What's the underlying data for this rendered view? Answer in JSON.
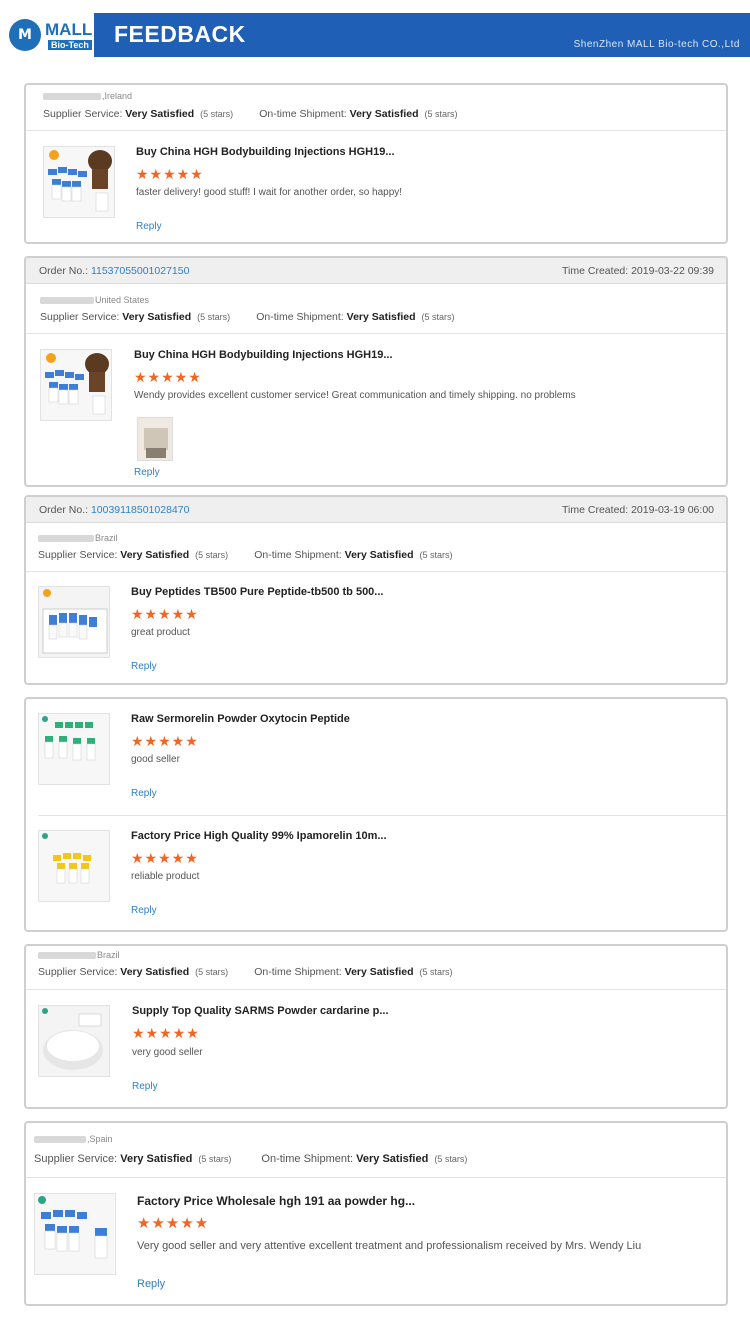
{
  "header": {
    "logo_mark": "M",
    "logo_text": "MALL",
    "logo_sub": "Bio-Tech",
    "title": "FEEDBACK",
    "company": "ShenZhen MALL Bio-tech CO.,Ltd"
  },
  "labels": {
    "order_no": "Order No.: ",
    "time_created": "Time Created: ",
    "supplier_service": "Supplier Service: ",
    "on_time_shipment": "On-time Shipment: ",
    "very_satisfied": "Very Satisfied",
    "five_stars": "(5 stars)",
    "reply": "Reply",
    "stars": "★★★★★"
  },
  "reviews": [
    {
      "country": ",Ireland",
      "product": "Buy China HGH Bodybuilding Injections HGH19...",
      "comment": "faster delivery! good stuff! I wait for another order, so happy!"
    },
    {
      "order_no": "11537055001027150",
      "time": "2019-03-22 09:39",
      "country": "United States",
      "product": "Buy China HGH Bodybuilding Injections HGH19...",
      "comment": "Wendy provides excellent customer service! Great communication and timely shipping. no problems"
    },
    {
      "order_no": "10039118501028470",
      "time": "2019-03-19 06:00",
      "country": "Brazil",
      "product": "Buy Peptides TB500 Pure Peptide-tb500 tb 500...",
      "comment": "great product"
    },
    {
      "product": "Raw Sermorelin Powder Oxytocin Peptide",
      "comment": "good seller"
    },
    {
      "product": "Factory Price High Quality 99% Ipamorelin 10m...",
      "comment": "reliable product"
    },
    {
      "country": "Brazil",
      "product": "Supply Top Quality SARMS Powder cardarine p...",
      "comment": "very good seller"
    },
    {
      "country": ",Spain",
      "product": "Factory Price Wholesale hgh 191 aa powder hg...",
      "comment": "Very good seller and very attentive excellent treatment and professionalism received by Mrs. Wendy Liu"
    }
  ],
  "colors": {
    "banner": "#1f5fb5",
    "star": "#f26522",
    "link": "#2f7fc8"
  }
}
